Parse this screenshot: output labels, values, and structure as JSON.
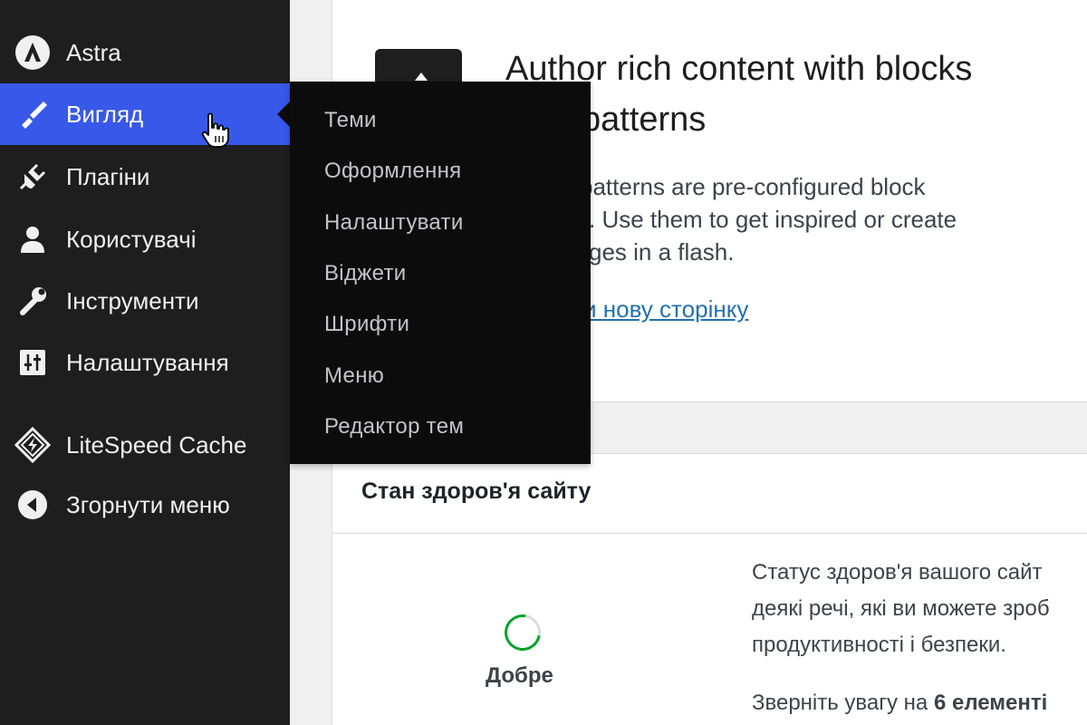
{
  "sidebar": {
    "items": [
      {
        "label": "Astra",
        "icon": "astra-logo-icon"
      },
      {
        "label": "Вигляд",
        "icon": "paintbrush-icon",
        "active": true
      },
      {
        "label": "Плагіни",
        "icon": "plugin-icon"
      },
      {
        "label": "Користувачі",
        "icon": "user-icon"
      },
      {
        "label": "Інструменти",
        "icon": "wrench-icon"
      },
      {
        "label": "Налаштування",
        "icon": "settings-sliders-icon"
      },
      {
        "label": "LiteSpeed Cache",
        "icon": "litespeed-icon"
      },
      {
        "label": "Згорнути меню",
        "icon": "collapse-arrow-icon"
      }
    ]
  },
  "submenu": {
    "items": [
      "Теми",
      "Оформлення",
      "Налаштувати",
      "Віджети",
      "Шрифти",
      "Меню",
      "Редактор тем"
    ]
  },
  "main": {
    "heading_line1": "Author rich content with blocks",
    "heading_line2": "patterns",
    "para_line1": "patterns are pre-configured block",
    "para_line2": ". Use them to get inspired or create",
    "para_line3": "ges in a flash.",
    "link": "и нову сторінку"
  },
  "health": {
    "title": "Стан здоров'я сайту",
    "status": "Добре",
    "text_line1": "Статус здоров'я вашого сайт",
    "text_line2": "деякі речі, які ви можете зроб",
    "text_line3": "продуктивності і безпеки.",
    "notice_prefix": "Зверніть увагу на ",
    "notice_bold": "6 елементі"
  },
  "colors": {
    "sidebar_bg": "#1e1e1e",
    "active_bg": "#3858e9",
    "submenu_bg": "#0c0c0c",
    "link": "#2271b1",
    "health_good": "#00a32a"
  }
}
